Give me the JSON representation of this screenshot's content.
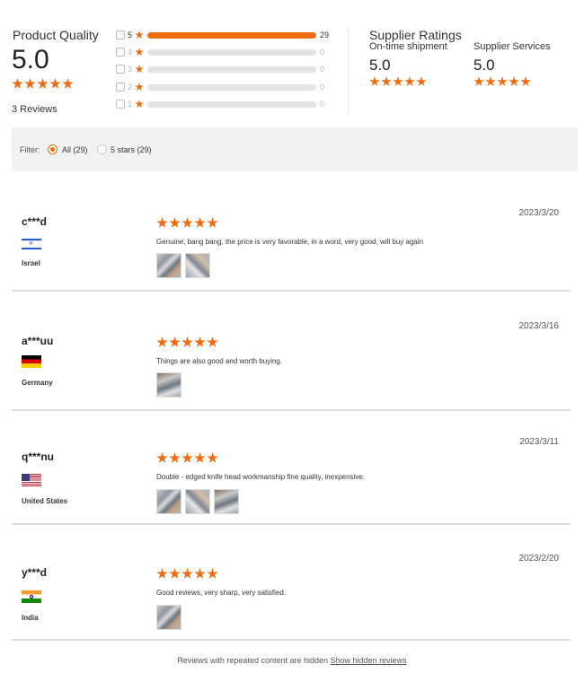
{
  "product_quality": {
    "title": "Product Quality",
    "score": "5.0",
    "rating": 5,
    "reviews_label": "3 Reviews"
  },
  "distribution": [
    {
      "stars": "5",
      "count": "29",
      "fraction": 1.0
    },
    {
      "stars": "4",
      "count": "0",
      "fraction": 0
    },
    {
      "stars": "3",
      "count": "0",
      "fraction": 0
    },
    {
      "stars": "2",
      "count": "0",
      "fraction": 0
    },
    {
      "stars": "1",
      "count": "0",
      "fraction": 0
    }
  ],
  "supplier": {
    "title": "Supplier Ratings",
    "shipment": {
      "label": "On-time shipment",
      "score": "5.0",
      "rating": 5
    },
    "services": {
      "label": "Supplier Services",
      "score": "5.0",
      "rating": 5
    }
  },
  "filter": {
    "label": "Filter:",
    "all": "All (29)",
    "five": "5 stars (29)",
    "selected": "all"
  },
  "reviews": [
    {
      "name": "c***d",
      "country": "Israel",
      "flag": "israel-flag",
      "rating": 5,
      "date": "2023/3/20",
      "text": "Genuine, bang bang, the price is very favorable, in a word, very good, will buy again",
      "photos": 2
    },
    {
      "name": "a***uu",
      "country": "Germany",
      "flag": "germany-flag",
      "rating": 5,
      "date": "2023/3/16",
      "text": "Things are also good and worth buying.",
      "photos": 1
    },
    {
      "name": "q***nu",
      "country": "United States",
      "flag": "united-states-flag",
      "rating": 5,
      "date": "2023/3/11",
      "text": "Double - edged knife head workmanship fine quality, inexpensive.",
      "photos": 3
    },
    {
      "name": "y***d",
      "country": "India",
      "flag": "india-flag",
      "rating": 5,
      "date": "2023/2/20",
      "text": "Good reviews, very sharp, very satisfied.",
      "photos": 1
    }
  ],
  "footer": {
    "note": "Reviews with repeated content are hidden",
    "link": "Show hidden reviews"
  },
  "colors": {
    "accent": "#ef6c10",
    "bar_bg": "#e4e4e4",
    "filter_bg": "#f2f2f2"
  }
}
